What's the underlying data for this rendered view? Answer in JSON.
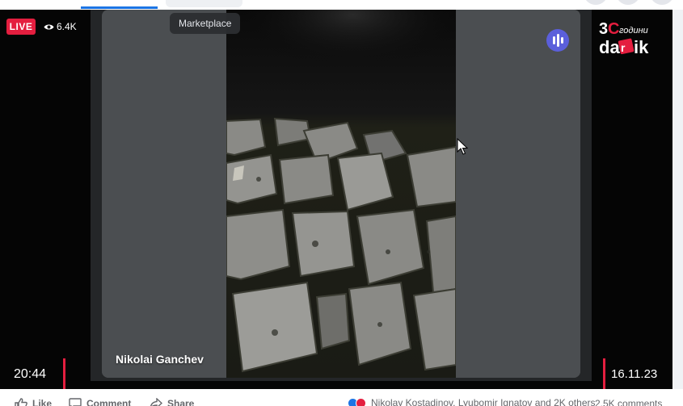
{
  "tooltip": {
    "label": "Marketplace"
  },
  "stream": {
    "live_label": "LIVE",
    "viewer_count": "6.4K",
    "speaker_name": "Nikolai Ganchev",
    "time": "20:44",
    "date": "16.11.23"
  },
  "logo": {
    "number": "30",
    "word_top": "години",
    "word_main": "dar",
    "word_k": "k"
  },
  "actions": {
    "like_label": "Like",
    "comment_label": "Comment",
    "share_label": "Share",
    "reactions_summary": "Nikolay Kostadinov, Lyubomir Ignatov and 2K others",
    "comments_count": "2.5K comments"
  },
  "colors": {
    "live_red": "#e41e3f",
    "audio_button": "#5b5fdb",
    "brand_blue": "#1b74e4"
  },
  "icons": {
    "viewers": "eye-icon",
    "audio": "audio-levels-icon",
    "like": "thumbs-up-icon",
    "comment": "speech-bubble-icon",
    "share": "share-arrow-icon",
    "cursor": "mouse-pointer-icon"
  }
}
